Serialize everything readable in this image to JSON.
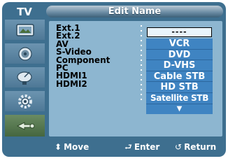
{
  "header": {
    "menu_title": "TV",
    "page_title": "Edit Name"
  },
  "sidebar": {
    "items": [
      {
        "icon": "picture-icon"
      },
      {
        "icon": "sound-icon"
      },
      {
        "icon": "channel-icon"
      },
      {
        "icon": "setup-icon"
      },
      {
        "icon": "input-icon",
        "active": true
      }
    ]
  },
  "sources": [
    "Ext.1",
    "Ext.2",
    "AV",
    "S-Video",
    "Component",
    "PC",
    "HDMI1",
    "HDMI2"
  ],
  "dropdown": {
    "current_value": "----",
    "options": [
      "VCR",
      "DVD",
      "D-VHS",
      "Cable STB",
      "HD STB",
      "Satellite STB"
    ],
    "more_arrow": "▼"
  },
  "footer": {
    "move_label": "Move",
    "enter_label": "Enter",
    "return_label": "Return",
    "move_glyph": "⬍",
    "enter_glyph": "⮐",
    "return_glyph": "↺"
  },
  "colors": {
    "background": "#3e6f8f",
    "panel": "#8db6d0",
    "dropdown": "#3f84c2"
  }
}
